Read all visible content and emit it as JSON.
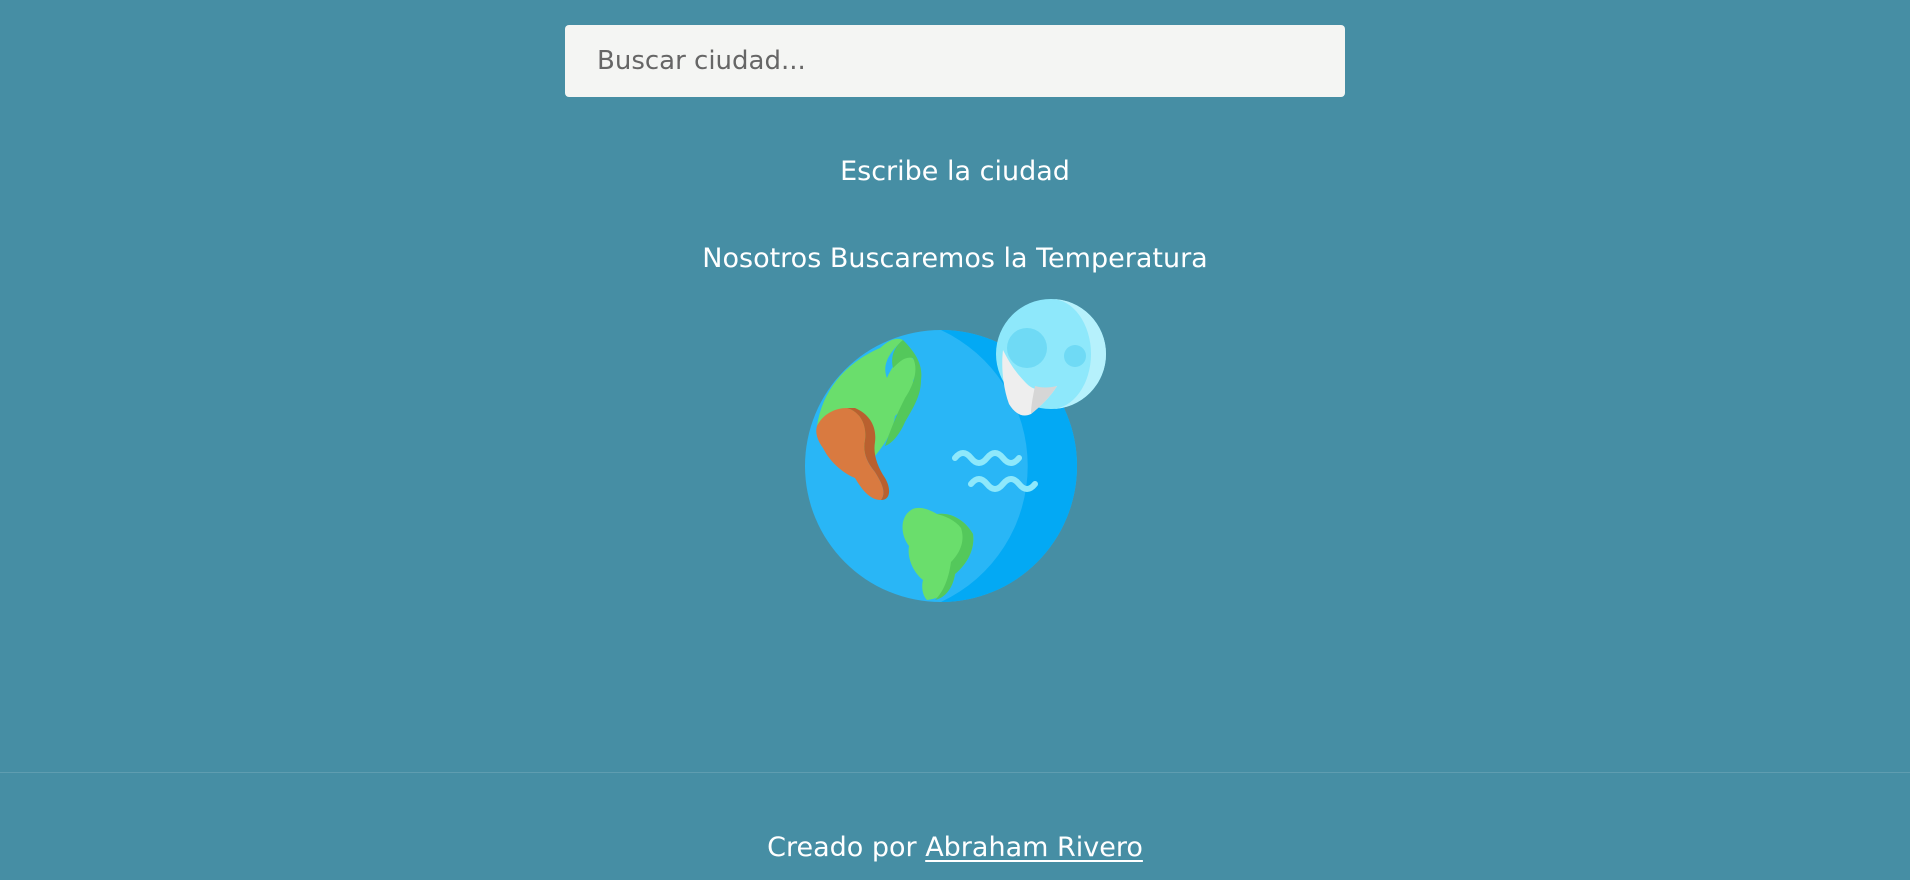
{
  "search": {
    "placeholder": "Buscar ciudad...",
    "value": ""
  },
  "main": {
    "line1": "Escribe la ciudad",
    "line2": "Nosotros Buscaremos la Temperatura",
    "illustration_icon": "globe-with-moon-icon"
  },
  "footer": {
    "prefix": "Creado por",
    "author_link": "Abraham Rivero"
  },
  "colors": {
    "background": "#468ea4",
    "search_bg": "#f4f5f3",
    "text": "#ffffff",
    "ocean": "#29b6f6",
    "land": "#6ade6c",
    "desert": "#d97a40",
    "moon": "#8ee8fb"
  }
}
